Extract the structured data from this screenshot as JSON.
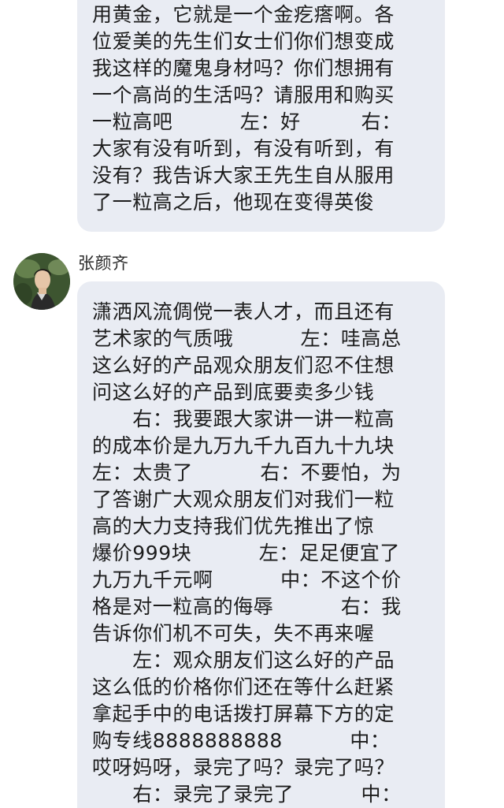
{
  "messages": [
    {
      "sender": "",
      "lines": [
        "用黄金，它就是一个金疙瘩啊。各",
        "位爱美的先生们女士们你们想变成",
        "我这样的魔鬼身材吗？你们想拥有",
        "一个高尚的生活吗？请服用和购买",
        "一粒高吧          左：好         右：",
        "大家有没有听到，有没有听到，有",
        "没有？我告诉大家王先生自从服用",
        "了一粒高之后，他现在变得英俊"
      ]
    },
    {
      "sender": "张颜齐",
      "avatar_icon": "user-avatar-photo",
      "lines": [
        "潇洒风流倜傥一表人才，而且还有",
        "艺术家的气质哦          左：哇高总",
        "这么好的产品观众朋友们忍不住想",
        "问这么好的产品到底要卖多少钱",
        "      右：我要跟大家讲一讲一粒高",
        "的成本价是九万九千九百九十九块",
        "左：太贵了          右：不要怕，为",
        "了答谢广大观众朋友们对我们一粒",
        "高的大力支持我们优先推出了惊",
        "爆价999块          左：足足便宜了",
        "九万九千元啊          中：不这个价",
        "格是对一粒高的侮辱          右：我",
        "告诉你们机不可失，失不再来喔",
        "      左：观众朋友们这么好的产品",
        "这么低的价格你们还在等什么赶紧",
        "拿起手中的电话拨打屏幕下方的定",
        "购专线8888888888          中：",
        "哎呀妈呀，录完了吗？录完了吗？",
        "      右：录完了录完了          中："
      ]
    }
  ],
  "colors": {
    "bubble": "#e9ecf3",
    "text": "#1c1c1c",
    "background": "#ffffff"
  }
}
